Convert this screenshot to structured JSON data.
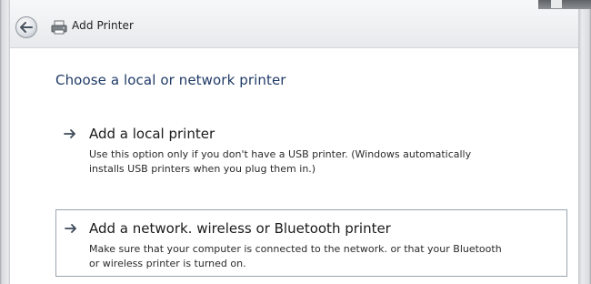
{
  "window": {
    "title": "Add Printer"
  },
  "icons": {
    "back": "back-arrow-icon",
    "printer": "printer-icon",
    "option_arrow": "arrow-right-icon"
  },
  "page": {
    "heading": "Choose a local or network printer"
  },
  "options": [
    {
      "title": "Add a local printer",
      "description_line1": "Use this option only if you don't have a USB printer. (Windows automatically",
      "description_line2": "installs USB printers when you plug them in.)"
    },
    {
      "title": "Add a network. wireless or Bluetooth printer",
      "description_line1": "Make sure that your computer is connected to the network. or that your Bluetooth",
      "description_line2": "or wireless printer is turned on."
    }
  ],
  "colors": {
    "heading": "#1f3a66",
    "option_border": "#9aa4ae"
  }
}
